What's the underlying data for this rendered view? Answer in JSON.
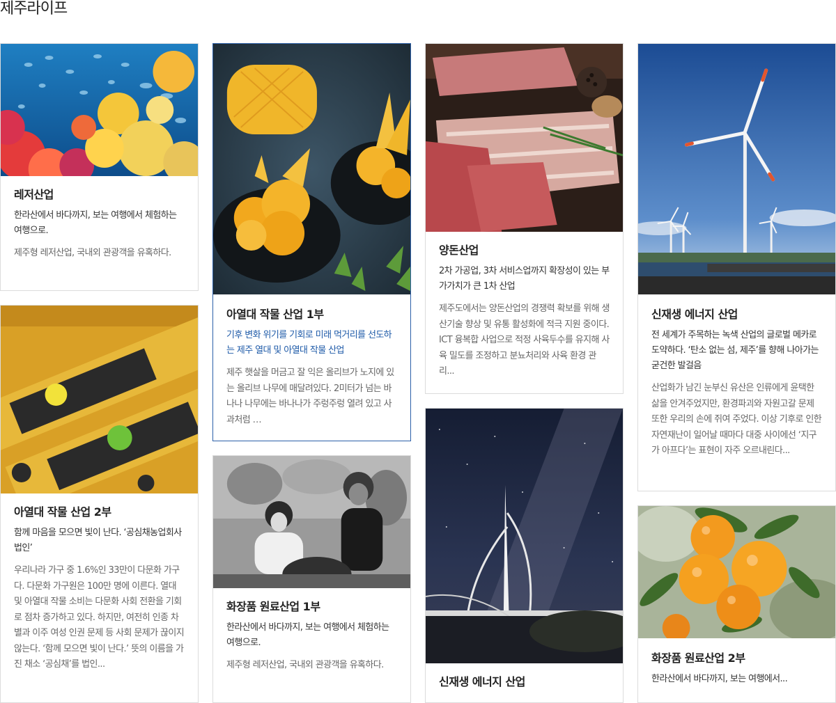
{
  "page": {
    "title": "제주라이프"
  },
  "cards": [
    {
      "title": "레저산업",
      "sub": "한라산에서 바다까지, 보는 여행에서 체험하는 여행으로.",
      "desc": "제주형 레저산업, 국내외 관광객을 유혹하다.",
      "image": "coral-reef-fish"
    },
    {
      "title": "아열대 작물 산업 2부",
      "sub": "함께 마음을 모으면 빛이 난다. ‘공심채농업회사법인’",
      "desc": "우리나라 가구 중 1.6%인 33만이 다문화 가구다. 다문화 가구원은 100만 명에 이른다. 열대 및 아열대 작물 소비는 다문화 사회 전환을 기회로 점차 증가하고 있다. 하지만, 여전히 인종 차별과 이주 여성 인권 문제 등 사회 문제가 끊이지 않는다. ‘함께 모으면 빛이 난다.’ 뜻의 이름을 가진 채소 ‘공심채’를 법인...",
      "image": "citrus-juice-bottles"
    },
    {
      "title": "아열대 작물 산업 1부",
      "sub": "기후 변화 위기를 기회로 미래 먹거리를 선도하는 제주 열대 및 아열대 작물 산업",
      "desc": "제주 햇살을 머금고 잘 익은 올리브가 노지에 있는 올리브 나무에 매달려있다. 2미터가 넘는 바나나 나무에는 바나나가 주렁주렁 열려 있고 사과처럼 …",
      "image": "mango-sorbet"
    },
    {
      "title": "화장품 원료산업 1부",
      "sub": "한라산에서 바다까지, 보는 여행에서 체험하는 여행으로.",
      "desc": "제주형 레저산업, 국내외 관광객을 유혹하다.",
      "image": "haenyeo-black-white"
    },
    {
      "title": "양돈산업",
      "sub": "2차 가공업, 3차 서비스업까지 확장성이 있는 부가가치가 큰 1차 산업",
      "desc": "제주도에서는 양돈산업의 경쟁력 확보를 위해 생산기술 향상 및 유통 활성화에 적극 지원 중이다. ICT 융복합 사업으로 적정 사육두수를 유지해 사육 밀도를 조정하고 분뇨처리와 사육 환경 관리...",
      "image": "pork-meat"
    },
    {
      "title": "신재생 에너지 산업",
      "image": "bridge-night-milky-way"
    },
    {
      "title": "신재생 에너지 산업",
      "sub": "전 세계가 주목하는 녹색 산업의 글로벌 메카로 도약하다. ‘탄소 없는 섬, 제주’를 향해 나아가는 굳건한 발걸음",
      "desc": "산업화가 남긴 눈부신 유산은 인류에게 윤택한 삶을 안겨주었지만, 환경파괴와 자원고갈 문제 또한 우리의 손에 쥐여 주었다. 이상 기후로 인한 자연재난이 일어날 때마다 대중 사이에선 ‘지구가 아프다’는 표현이 자주 오르내린다...",
      "image": "wind-turbines"
    },
    {
      "title": "화장품 원료산업 2부",
      "sub": "한라산에서 바다까지, 보는 여행에서...",
      "image": "tangerines"
    }
  ]
}
